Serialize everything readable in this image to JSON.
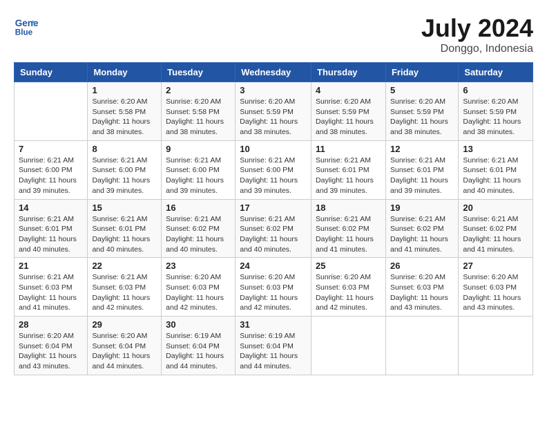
{
  "header": {
    "logo_line1": "General",
    "logo_line2": "Blue",
    "month": "July 2024",
    "location": "Donggo, Indonesia"
  },
  "columns": [
    "Sunday",
    "Monday",
    "Tuesday",
    "Wednesday",
    "Thursday",
    "Friday",
    "Saturday"
  ],
  "weeks": [
    [
      {
        "day": "",
        "info": ""
      },
      {
        "day": "1",
        "info": "Sunrise: 6:20 AM\nSunset: 5:58 PM\nDaylight: 11 hours and 38 minutes."
      },
      {
        "day": "2",
        "info": "Sunrise: 6:20 AM\nSunset: 5:58 PM\nDaylight: 11 hours and 38 minutes."
      },
      {
        "day": "3",
        "info": "Sunrise: 6:20 AM\nSunset: 5:59 PM\nDaylight: 11 hours and 38 minutes."
      },
      {
        "day": "4",
        "info": "Sunrise: 6:20 AM\nSunset: 5:59 PM\nDaylight: 11 hours and 38 minutes."
      },
      {
        "day": "5",
        "info": "Sunrise: 6:20 AM\nSunset: 5:59 PM\nDaylight: 11 hours and 38 minutes."
      },
      {
        "day": "6",
        "info": "Sunrise: 6:20 AM\nSunset: 5:59 PM\nDaylight: 11 hours and 38 minutes."
      }
    ],
    [
      {
        "day": "7",
        "info": "Sunrise: 6:21 AM\nSunset: 6:00 PM\nDaylight: 11 hours and 39 minutes."
      },
      {
        "day": "8",
        "info": "Sunrise: 6:21 AM\nSunset: 6:00 PM\nDaylight: 11 hours and 39 minutes."
      },
      {
        "day": "9",
        "info": "Sunrise: 6:21 AM\nSunset: 6:00 PM\nDaylight: 11 hours and 39 minutes."
      },
      {
        "day": "10",
        "info": "Sunrise: 6:21 AM\nSunset: 6:00 PM\nDaylight: 11 hours and 39 minutes."
      },
      {
        "day": "11",
        "info": "Sunrise: 6:21 AM\nSunset: 6:01 PM\nDaylight: 11 hours and 39 minutes."
      },
      {
        "day": "12",
        "info": "Sunrise: 6:21 AM\nSunset: 6:01 PM\nDaylight: 11 hours and 39 minutes."
      },
      {
        "day": "13",
        "info": "Sunrise: 6:21 AM\nSunset: 6:01 PM\nDaylight: 11 hours and 40 minutes."
      }
    ],
    [
      {
        "day": "14",
        "info": "Sunrise: 6:21 AM\nSunset: 6:01 PM\nDaylight: 11 hours and 40 minutes."
      },
      {
        "day": "15",
        "info": "Sunrise: 6:21 AM\nSunset: 6:01 PM\nDaylight: 11 hours and 40 minutes."
      },
      {
        "day": "16",
        "info": "Sunrise: 6:21 AM\nSunset: 6:02 PM\nDaylight: 11 hours and 40 minutes."
      },
      {
        "day": "17",
        "info": "Sunrise: 6:21 AM\nSunset: 6:02 PM\nDaylight: 11 hours and 40 minutes."
      },
      {
        "day": "18",
        "info": "Sunrise: 6:21 AM\nSunset: 6:02 PM\nDaylight: 11 hours and 41 minutes."
      },
      {
        "day": "19",
        "info": "Sunrise: 6:21 AM\nSunset: 6:02 PM\nDaylight: 11 hours and 41 minutes."
      },
      {
        "day": "20",
        "info": "Sunrise: 6:21 AM\nSunset: 6:02 PM\nDaylight: 11 hours and 41 minutes."
      }
    ],
    [
      {
        "day": "21",
        "info": "Sunrise: 6:21 AM\nSunset: 6:03 PM\nDaylight: 11 hours and 41 minutes."
      },
      {
        "day": "22",
        "info": "Sunrise: 6:21 AM\nSunset: 6:03 PM\nDaylight: 11 hours and 42 minutes."
      },
      {
        "day": "23",
        "info": "Sunrise: 6:20 AM\nSunset: 6:03 PM\nDaylight: 11 hours and 42 minutes."
      },
      {
        "day": "24",
        "info": "Sunrise: 6:20 AM\nSunset: 6:03 PM\nDaylight: 11 hours and 42 minutes."
      },
      {
        "day": "25",
        "info": "Sunrise: 6:20 AM\nSunset: 6:03 PM\nDaylight: 11 hours and 42 minutes."
      },
      {
        "day": "26",
        "info": "Sunrise: 6:20 AM\nSunset: 6:03 PM\nDaylight: 11 hours and 43 minutes."
      },
      {
        "day": "27",
        "info": "Sunrise: 6:20 AM\nSunset: 6:03 PM\nDaylight: 11 hours and 43 minutes."
      }
    ],
    [
      {
        "day": "28",
        "info": "Sunrise: 6:20 AM\nSunset: 6:04 PM\nDaylight: 11 hours and 43 minutes."
      },
      {
        "day": "29",
        "info": "Sunrise: 6:20 AM\nSunset: 6:04 PM\nDaylight: 11 hours and 44 minutes."
      },
      {
        "day": "30",
        "info": "Sunrise: 6:19 AM\nSunset: 6:04 PM\nDaylight: 11 hours and 44 minutes."
      },
      {
        "day": "31",
        "info": "Sunrise: 6:19 AM\nSunset: 6:04 PM\nDaylight: 11 hours and 44 minutes."
      },
      {
        "day": "",
        "info": ""
      },
      {
        "day": "",
        "info": ""
      },
      {
        "day": "",
        "info": ""
      }
    ]
  ]
}
